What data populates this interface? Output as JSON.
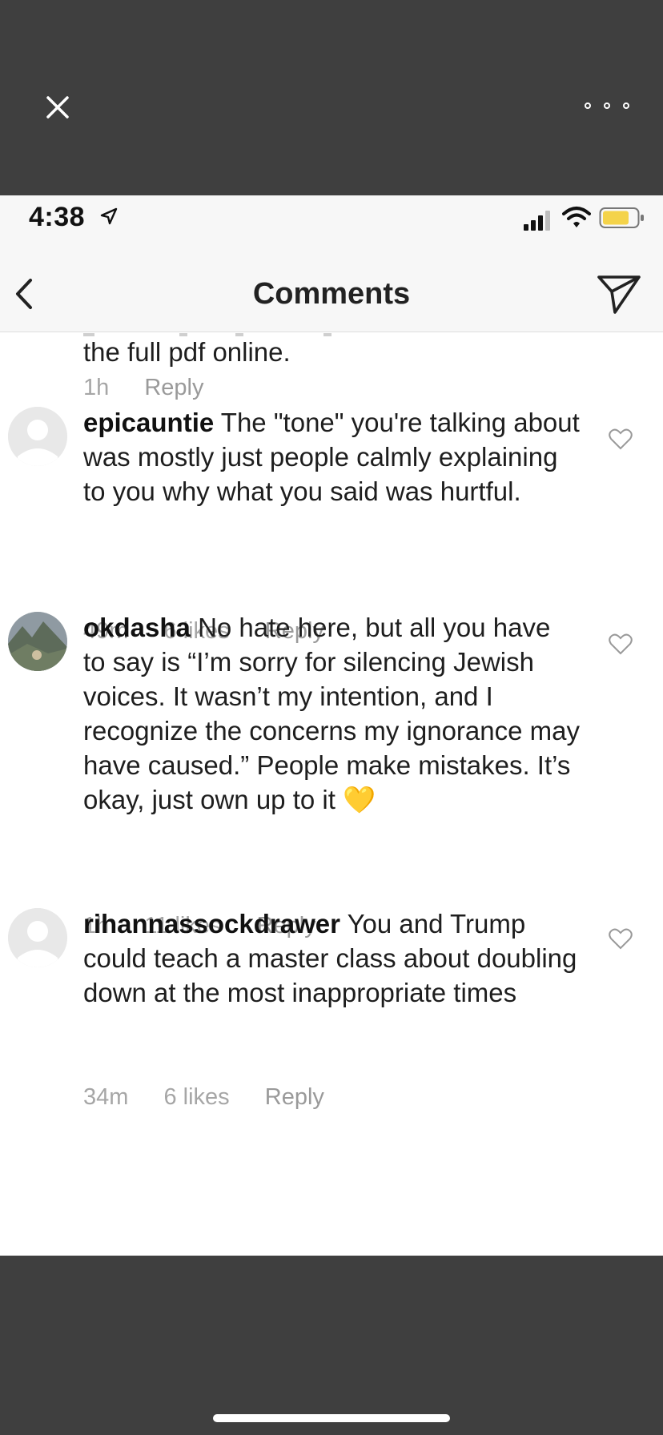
{
  "viewer": {
    "close_icon": "close-icon",
    "more_icon": "more-options-icon"
  },
  "status_bar": {
    "time": "4:38",
    "icons": [
      "location-arrow-icon",
      "cellular-signal-icon",
      "wifi-icon",
      "battery-icon"
    ],
    "battery_color": "#f4d34a"
  },
  "nav": {
    "title": "Comments",
    "back_icon": "chevron-left-icon",
    "send_icon": "send-icon"
  },
  "comments": [
    {
      "text": "the full pdf online.",
      "time": "1h",
      "reply": "Reply"
    },
    {
      "username": "epicauntie",
      "text": "The \"tone\" you're talking about was mostly just people calmly explaining to you why what you said was hurtful.",
      "time": "49m",
      "likes": "6 likes",
      "reply": "Reply"
    },
    {
      "username": "okdasha",
      "text": "No hate here, but all you have to say is “I’m sorry for silencing Jewish voices. It wasn’t my intention, and I recognize the concerns my ignorance may have caused.” People make mistakes. It’s okay, just own up to it",
      "emoji": "💛",
      "time": "1h",
      "likes": "11 likes",
      "reply": "Reply"
    },
    {
      "username": "rihannassockdrawer",
      "text": "You and Trump could teach a master class about doubling down at the most inappropriate times",
      "time": "34m",
      "likes": "6 likes",
      "reply": "Reply"
    }
  ],
  "colors": {
    "frame": "#3f3f3f",
    "meta_text": "#a6a6a6",
    "emoji_heart": "#f2c94c"
  }
}
